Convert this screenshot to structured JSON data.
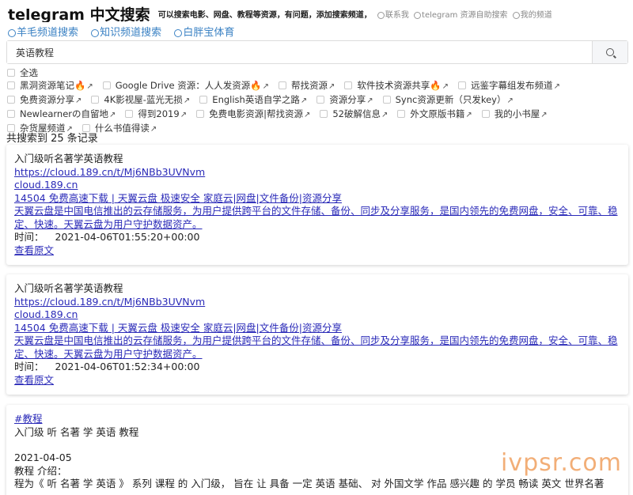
{
  "header": {
    "title": "telegram 中文搜索",
    "subtitle": "可以搜索电影、网盘、教程等资源，有问题，添加搜索频道，",
    "link1": "联系我",
    "link2": "telegram 资源自助搜索",
    "link3": "我的频道"
  },
  "nav": {
    "item1": "羊毛频道搜索",
    "item2": "知识频道搜索",
    "item3": "白胖宝体育"
  },
  "search": {
    "value": "英语教程",
    "icon": "search-icon"
  },
  "filters": {
    "select_all": "全选",
    "items": [
      "黑洞资源笔记🔥",
      "Google Drive 资源：人人发资源🔥",
      "帮找资源",
      "软件技术资源共享🔥",
      "远鉴字幕组发布频道",
      "免费资源分享",
      "4K影视屋-蓝光无损",
      "English英语自学之路",
      "资源分享",
      "Sync资源更新（只发key）",
      "Newlearnerの自留地",
      "得到2019",
      "免费电影资源|帮找资源",
      "52破解信息",
      "外文原版书籍",
      "我的小书屋",
      "杂货屋频道",
      "什么书值得读"
    ],
    "arrow": "↗"
  },
  "result_count": "共搜索到 25 条记录",
  "results": [
    {
      "title": "入门级听名著学英语教程",
      "url": "https://cloud.189.cn/t/Mj6NBb3UVNvm",
      "domain": "cloud.189.cn",
      "desc1": "14504 免费高速下载 | 天翼云盘 极速安全 家庭云|网盘|文件备份|资源分享",
      "desc2": "天翼云盘是中国电信推出的云存储服务，为用户提供跨平台的文件存储、备份、同步及分享服务，是国内领先的免费网盘，安全、可靠、稳定、快速。天翼云盘为用户守护数据资产。",
      "time_label": "时间：",
      "time": "2021-04-06T01:55:20+00:00",
      "view": "查看原文"
    },
    {
      "title": "入门级听名著学英语教程",
      "url": "https://cloud.189.cn/t/Mj6NBb3UVNvm",
      "domain": "cloud.189.cn",
      "desc1": "14504 免费高速下载 | 天翼云盘 极速安全 家庭云|网盘|文件备份|资源分享",
      "desc2": "天翼云盘是中国电信推出的云存储服务，为用户提供跨平台的文件存储、备份、同步及分享服务，是国内领先的免费网盘，安全、可靠、稳定、快速。天翼云盘为用户守护数据资产。",
      "time_label": "时间：",
      "time": "2021-04-06T01:52:34+00:00",
      "view": "查看原文"
    }
  ],
  "post": {
    "tag": "#教程",
    "title": "入门级 听 名著 学 英语 教程",
    "date": "2021-04-05",
    "intro_label": "教程 介绍：",
    "body": "程为《 听 名著 学 英语 》 系列 课程 的 入门级， 旨在 让 具备 一定 英语 基础、 对 外国文学 作品 感兴趣 的 学员 畅读 英文 世界名著"
  },
  "watermark": "ivpsr.com"
}
